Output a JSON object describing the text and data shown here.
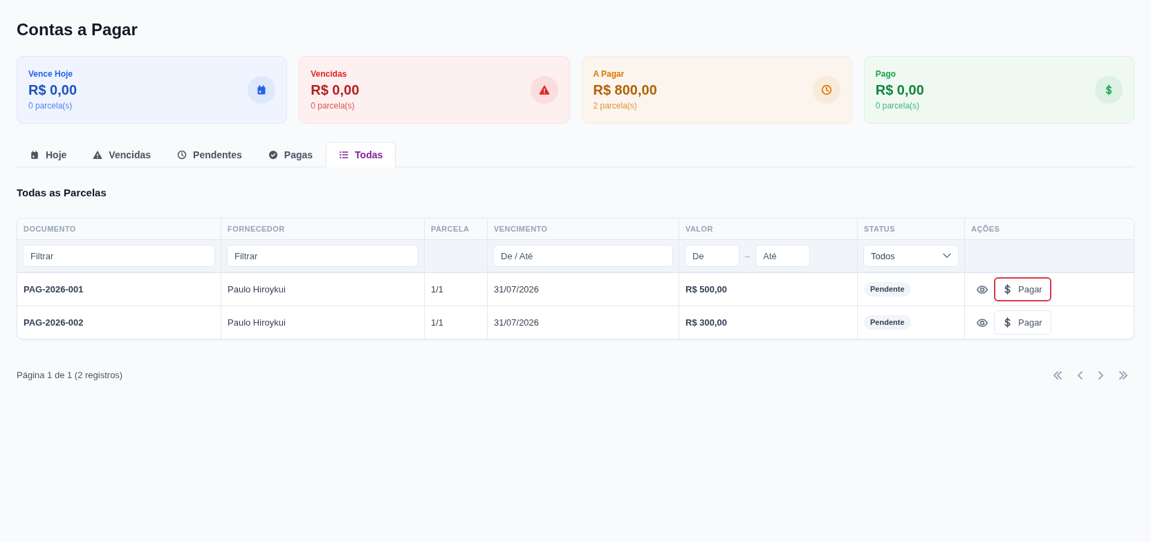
{
  "page": {
    "title": "Contas a Pagar"
  },
  "cards": [
    {
      "kind": "today",
      "label": "Vence Hoje",
      "value": "R$ 0,00",
      "sub": "0 parcela(s)",
      "color": "#2563eb"
    },
    {
      "kind": "overdue",
      "label": "Vencidas",
      "value": "R$ 0,00",
      "sub": "0 parcela(s)",
      "color": "#dc2626"
    },
    {
      "kind": "pending",
      "label": "A Pagar",
      "value": "R$ 800,00",
      "sub": "2 parcela(s)",
      "color": "#d97706"
    },
    {
      "kind": "paid",
      "label": "Pago",
      "value": "R$ 0,00",
      "sub": "0 parcela(s)",
      "color": "#16a34a"
    }
  ],
  "tabs": [
    {
      "kind": "today",
      "label": "Hoje",
      "selected": false
    },
    {
      "kind": "overdue",
      "label": "Vencidas",
      "selected": false
    },
    {
      "kind": "pending",
      "label": "Pendentes",
      "selected": false
    },
    {
      "kind": "paid",
      "label": "Pagas",
      "selected": false
    },
    {
      "kind": "all",
      "label": "Todas",
      "selected": true
    }
  ],
  "section_title": "Todas as Parcelas",
  "table": {
    "columns": [
      "DOCUMENTO",
      "FORNECEDOR",
      "PARCELA",
      "VENCIMENTO",
      "VALOR",
      "STATUS",
      "AÇÕES"
    ],
    "filters": [
      {
        "kind": "text",
        "placeholder": "Filtrar"
      },
      {
        "kind": "text",
        "placeholder": "Filtrar"
      },
      {
        "kind": "none"
      },
      {
        "kind": "text",
        "placeholder": "De / Até"
      },
      {
        "kind": "range",
        "from_placeholder": "De",
        "separator": "–",
        "to_placeholder": "Até"
      },
      {
        "kind": "select",
        "value": "Todos"
      },
      {
        "kind": "none"
      }
    ],
    "rows": [
      {
        "document": "PAG-2026-001",
        "supplier": "Paulo Hiroykui",
        "installment": "1/1",
        "due_date": "31/07/2026",
        "amount": "R$ 500,00",
        "status": "Pendente",
        "pay_label": "Pagar",
        "pay_focused": true
      },
      {
        "document": "PAG-2026-002",
        "supplier": "Paulo Hiroykui",
        "installment": "1/1",
        "due_date": "31/07/2026",
        "amount": "R$ 300,00",
        "status": "Pendente",
        "pay_label": "Pagar",
        "pay_focused": false
      }
    ]
  },
  "pagination": {
    "summary": "Página 1 de 1 (2 registros)",
    "buttons": [
      {
        "kind": "first",
        "disabled": true
      },
      {
        "kind": "prev",
        "disabled": true
      },
      {
        "kind": "next",
        "disabled": true
      },
      {
        "kind": "last",
        "disabled": true
      }
    ]
  }
}
